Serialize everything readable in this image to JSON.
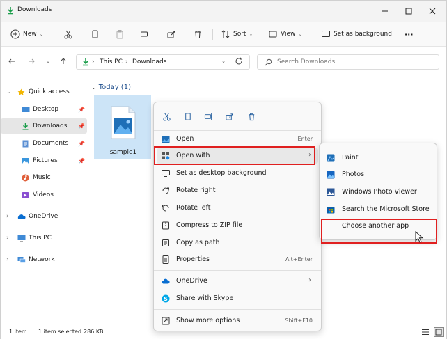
{
  "window": {
    "title": "Downloads"
  },
  "toolbar": {
    "new_label": "New",
    "sort_label": "Sort",
    "view_label": "View",
    "set_bg_label": "Set as background",
    "more_label": "···"
  },
  "address": {
    "crumbs": [
      "This PC",
      "Downloads"
    ],
    "search_placeholder": "Search Downloads"
  },
  "sidebar": {
    "items": [
      {
        "label": "Quick access"
      },
      {
        "label": "Desktop"
      },
      {
        "label": "Downloads"
      },
      {
        "label": "Documents"
      },
      {
        "label": "Pictures"
      },
      {
        "label": "Music"
      },
      {
        "label": "Videos"
      },
      {
        "label": "OneDrive"
      },
      {
        "label": "This PC"
      },
      {
        "label": "Network"
      }
    ]
  },
  "content": {
    "group_label": "Today (1)",
    "file_name": "sample1"
  },
  "context_menu": {
    "items": [
      {
        "label": "Open",
        "shortcut": "Enter"
      },
      {
        "label": "Open with",
        "shortcut": ""
      },
      {
        "label": "Set as desktop background",
        "shortcut": ""
      },
      {
        "label": "Rotate right",
        "shortcut": ""
      },
      {
        "label": "Rotate left",
        "shortcut": ""
      },
      {
        "label": "Compress to ZIP file",
        "shortcut": ""
      },
      {
        "label": "Copy as path",
        "shortcut": ""
      },
      {
        "label": "Properties",
        "shortcut": "Alt+Enter"
      },
      {
        "label": "OneDrive",
        "shortcut": ""
      },
      {
        "label": "Share with Skype",
        "shortcut": ""
      },
      {
        "label": "Show more options",
        "shortcut": "Shift+F10"
      }
    ]
  },
  "open_with_menu": {
    "items": [
      {
        "label": "Paint"
      },
      {
        "label": "Photos"
      },
      {
        "label": "Windows Photo Viewer"
      },
      {
        "label": "Search the Microsoft Store"
      },
      {
        "label": "Choose another app"
      }
    ]
  },
  "status_bar": {
    "item_count": "1 item",
    "selection": "1 item selected",
    "size": "286 KB"
  },
  "colors": {
    "accent": "#0067c0",
    "highlight_box": "#e02020",
    "selected_tile": "#cce4f7"
  }
}
